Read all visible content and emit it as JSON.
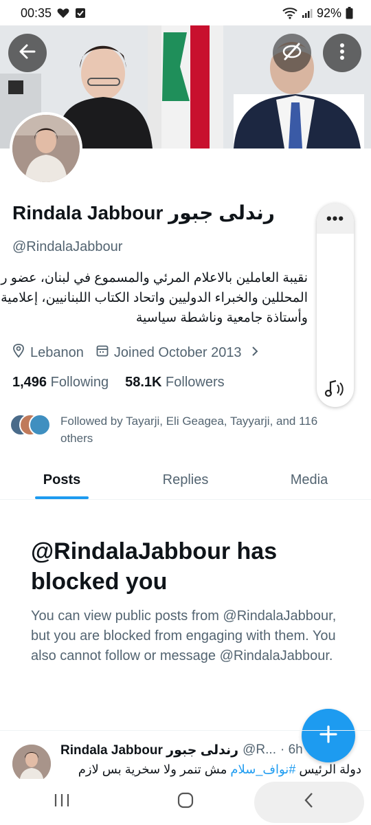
{
  "status_bar": {
    "time": "00:35",
    "battery": "92%"
  },
  "profile": {
    "display_name": "Rindala Jabbour رندلى جبور",
    "handle": "@RindalaJabbour",
    "bio_lines": [
      "نقيبة العاملين بالاعلام المرئي والمسموع في لبنان، عضو رابطة",
      "المحللين والخبراء الدوليين واتحاد الكتاب اللبنانيين، إعلامية وكاتبة",
      "وأستاذة جامعية وناشطة سياسية"
    ],
    "location": "Lebanon",
    "joined": "Joined October 2013",
    "following_count": "1,496",
    "following_label": "Following",
    "followers_count": "58.1K",
    "followers_label": "Followers",
    "followed_by": "Followed by Tayarji, Eli Geagea, Tayyarji, and 116 others"
  },
  "side_pill": {
    "more_label": "•••"
  },
  "tabs": [
    {
      "label": "Posts",
      "active": true
    },
    {
      "label": "Replies",
      "active": false
    },
    {
      "label": "Media",
      "active": false
    }
  ],
  "blocked": {
    "title": "@RindalaJabbour has blocked you",
    "body": "You can view public posts from @RindalaJabbour, but you are blocked from engaging with them. You also cannot follow or message @RindalaJabbour."
  },
  "tweet": {
    "name": "Rindala Jabbour رندلى جبور",
    "handle": "@R...",
    "time": "· 6h",
    "text_prefix": "دولة الرئيس ",
    "hashtag": "#نواف_سلام",
    "text_suffix": " مش تنمر ولا سخرية بس لازم"
  },
  "colors": {
    "accent": "#1d9bf0",
    "text_primary": "#0f1419",
    "text_secondary": "#536471"
  },
  "icons": [
    "back-arrow-icon",
    "blocked-eye-icon",
    "more-vertical-icon",
    "location-pin-icon",
    "calendar-icon",
    "chevron-right-icon",
    "music-sound-icon",
    "plus-icon",
    "recent-apps-icon",
    "home-circle-icon",
    "back-chevron-icon"
  ]
}
